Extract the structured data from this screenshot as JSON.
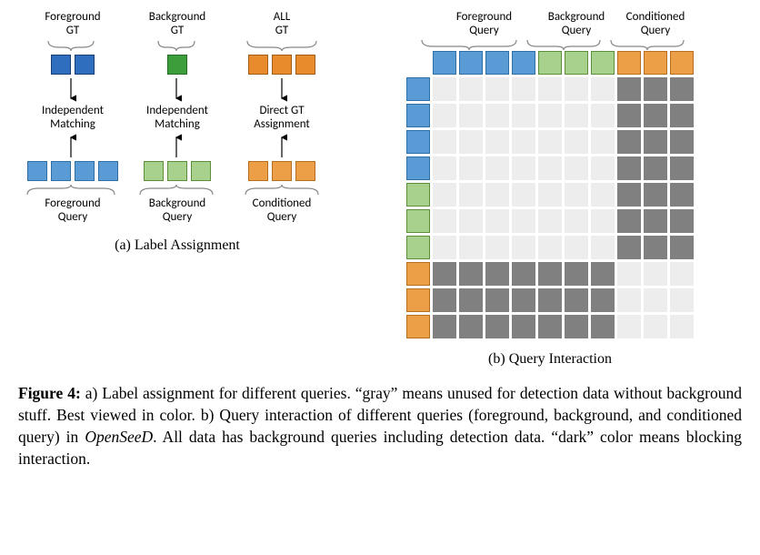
{
  "colors": {
    "fg_gt": {
      "fill": "#2F6DBF",
      "border": "#1A3F75"
    },
    "bg_gt": {
      "fill": "#3B9E3B",
      "border": "#276A27"
    },
    "all_gt": {
      "fill": "#E88B2D",
      "border": "#A35C14"
    },
    "fg_q": {
      "fill": "#5B9BD5",
      "border": "#2E6FA6"
    },
    "bg_q": {
      "fill": "#A8D18D",
      "border": "#5B8F3A"
    },
    "cond_q": {
      "fill": "#ED9F47",
      "border": "#B56F1E"
    }
  },
  "panel_a": {
    "top_labels": [
      "Foreground\nGT",
      "Background\nGT",
      "ALL\nGT"
    ],
    "gt_counts": {
      "fg": 2,
      "bg": 1,
      "all": 3
    },
    "match_labels": [
      "Independent\nMatching",
      "Independent\nMatching",
      "Direct GT\nAssignment"
    ],
    "query_counts": {
      "fg": 4,
      "bg": 3,
      "cond": 3
    },
    "bottom_labels": [
      "Foreground\nQuery",
      "Background\nQuery",
      "Conditioned\nQuery"
    ],
    "subcaption": "(a) Label Assignment"
  },
  "panel_b": {
    "top_headers": [
      "Foreground\nQuery",
      "Background\nQuery",
      "Conditioned\nQuery"
    ],
    "left_counts": {
      "fg": 4,
      "bg": 3,
      "cond": 3
    },
    "subcaption": "(b) Query Interaction"
  },
  "caption": {
    "lead": "Figure 4:",
    "body_a": " a) Label assignment for different queries. “gray” means unused for detection data without background stuff. Best viewed in color. b) Query interaction of different queries (foreground, background, and conditioned query) in ",
    "model": "OpenSeeD",
    "body_b": ". All data has background queries including detection data. “dark” color means blocking interaction."
  },
  "chart_data": {
    "type": "heatmap",
    "description": "Query interaction mask. Rows = keys, Cols = queries. 'dark' = blocked interaction, 'light' = allowed.",
    "row_groups": [
      "fg",
      "fg",
      "fg",
      "fg",
      "bg",
      "bg",
      "bg",
      "cond",
      "cond",
      "cond"
    ],
    "col_groups": [
      "fg",
      "fg",
      "fg",
      "fg",
      "bg",
      "bg",
      "bg",
      "cond",
      "cond",
      "cond"
    ],
    "values": [
      [
        "light",
        "light",
        "light",
        "light",
        "light",
        "light",
        "light",
        "dark",
        "dark",
        "dark"
      ],
      [
        "light",
        "light",
        "light",
        "light",
        "light",
        "light",
        "light",
        "dark",
        "dark",
        "dark"
      ],
      [
        "light",
        "light",
        "light",
        "light",
        "light",
        "light",
        "light",
        "dark",
        "dark",
        "dark"
      ],
      [
        "light",
        "light",
        "light",
        "light",
        "light",
        "light",
        "light",
        "dark",
        "dark",
        "dark"
      ],
      [
        "light",
        "light",
        "light",
        "light",
        "light",
        "light",
        "light",
        "dark",
        "dark",
        "dark"
      ],
      [
        "light",
        "light",
        "light",
        "light",
        "light",
        "light",
        "light",
        "dark",
        "dark",
        "dark"
      ],
      [
        "light",
        "light",
        "light",
        "light",
        "light",
        "light",
        "light",
        "dark",
        "dark",
        "dark"
      ],
      [
        "dark",
        "dark",
        "dark",
        "dark",
        "dark",
        "dark",
        "dark",
        "light",
        "light",
        "light"
      ],
      [
        "dark",
        "dark",
        "dark",
        "dark",
        "dark",
        "dark",
        "dark",
        "light",
        "light",
        "light"
      ],
      [
        "dark",
        "dark",
        "dark",
        "dark",
        "dark",
        "dark",
        "dark",
        "light",
        "light",
        "light"
      ]
    ]
  }
}
